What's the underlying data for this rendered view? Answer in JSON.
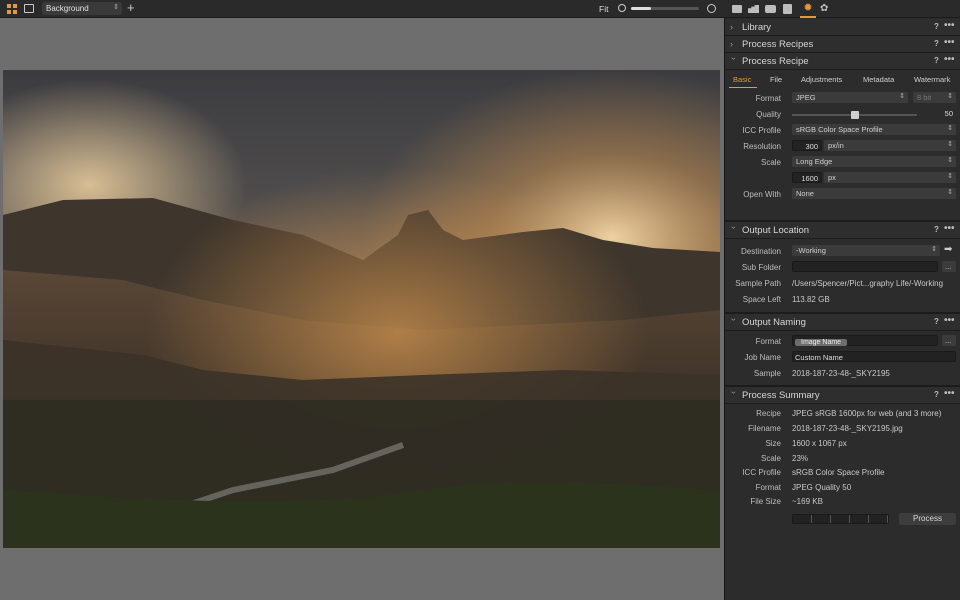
{
  "toolbar": {
    "layer_select": "Background",
    "zoom_label": "Fit",
    "zoom_fraction": 0.3
  },
  "tool_tabs": [
    "folder-icon",
    "camera-stack-icon",
    "camera-icon",
    "checklist-icon",
    "gear-icon",
    "adjust-icon"
  ],
  "sections": {
    "library": "Library",
    "process_recipes": "Process Recipes",
    "process_recipe": "Process Recipe",
    "output_location": "Output Location",
    "output_naming": "Output Naming",
    "process_summary": "Process Summary",
    "help": "?",
    "more": "•••"
  },
  "recipe": {
    "tabs": [
      "Basic",
      "File",
      "Adjustments",
      "Metadata",
      "Watermark"
    ],
    "format_label": "Format",
    "format_value": "JPEG",
    "bit_value": "8 bit",
    "quality_label": "Quality",
    "quality_value": "50",
    "quality_fraction": 0.5,
    "icc_label": "ICC Profile",
    "icc_value": "sRGB Color Space Profile",
    "resolution_label": "Resolution",
    "resolution_value": "300",
    "resolution_unit": "px/in",
    "scale_label": "Scale",
    "scale_value": "Long Edge",
    "scale_size": "1600",
    "scale_unit": "px",
    "open_with_label": "Open With",
    "open_with_value": "None"
  },
  "location": {
    "destination_label": "Destination",
    "destination_value": "-Working",
    "subfolder_label": "Sub Folder",
    "subfolder_button": "...",
    "sample_path_label": "Sample Path",
    "sample_path_value": "/Users/Spencer/Pict...graphy Life/-Working",
    "space_left_label": "Space Left",
    "space_left_value": "113.82 GB"
  },
  "naming": {
    "format_label": "Format",
    "format_token": "Image Name",
    "format_button": "...",
    "job_name_label": "Job Name",
    "job_name_value": "Custom Name",
    "sample_label": "Sample",
    "sample_value": "2018-187-23-48-_SKY2195"
  },
  "summary": {
    "recipe_label": "Recipe",
    "recipe_value": "JPEG sRGB 1600px for web (and 3 more)",
    "filename_label": "Filename",
    "filename_value": "2018-187-23-48-_SKY2195.jpg",
    "size_label": "Size",
    "size_value": "1600 x 1067 px",
    "scale_label": "Scale",
    "scale_value": "23%",
    "icc_label": "ICC Profile",
    "icc_value": "sRGB Color Space Profile",
    "format_label": "Format",
    "format_value": "JPEG Quality 50",
    "filesize_label": "File Size",
    "filesize_value": "~169 KB",
    "process_button": "Process"
  },
  "colors": {
    "accent": "#e8973a",
    "panel_bg": "#2c2c2c",
    "viewer_bg": "#6e6e6e"
  }
}
